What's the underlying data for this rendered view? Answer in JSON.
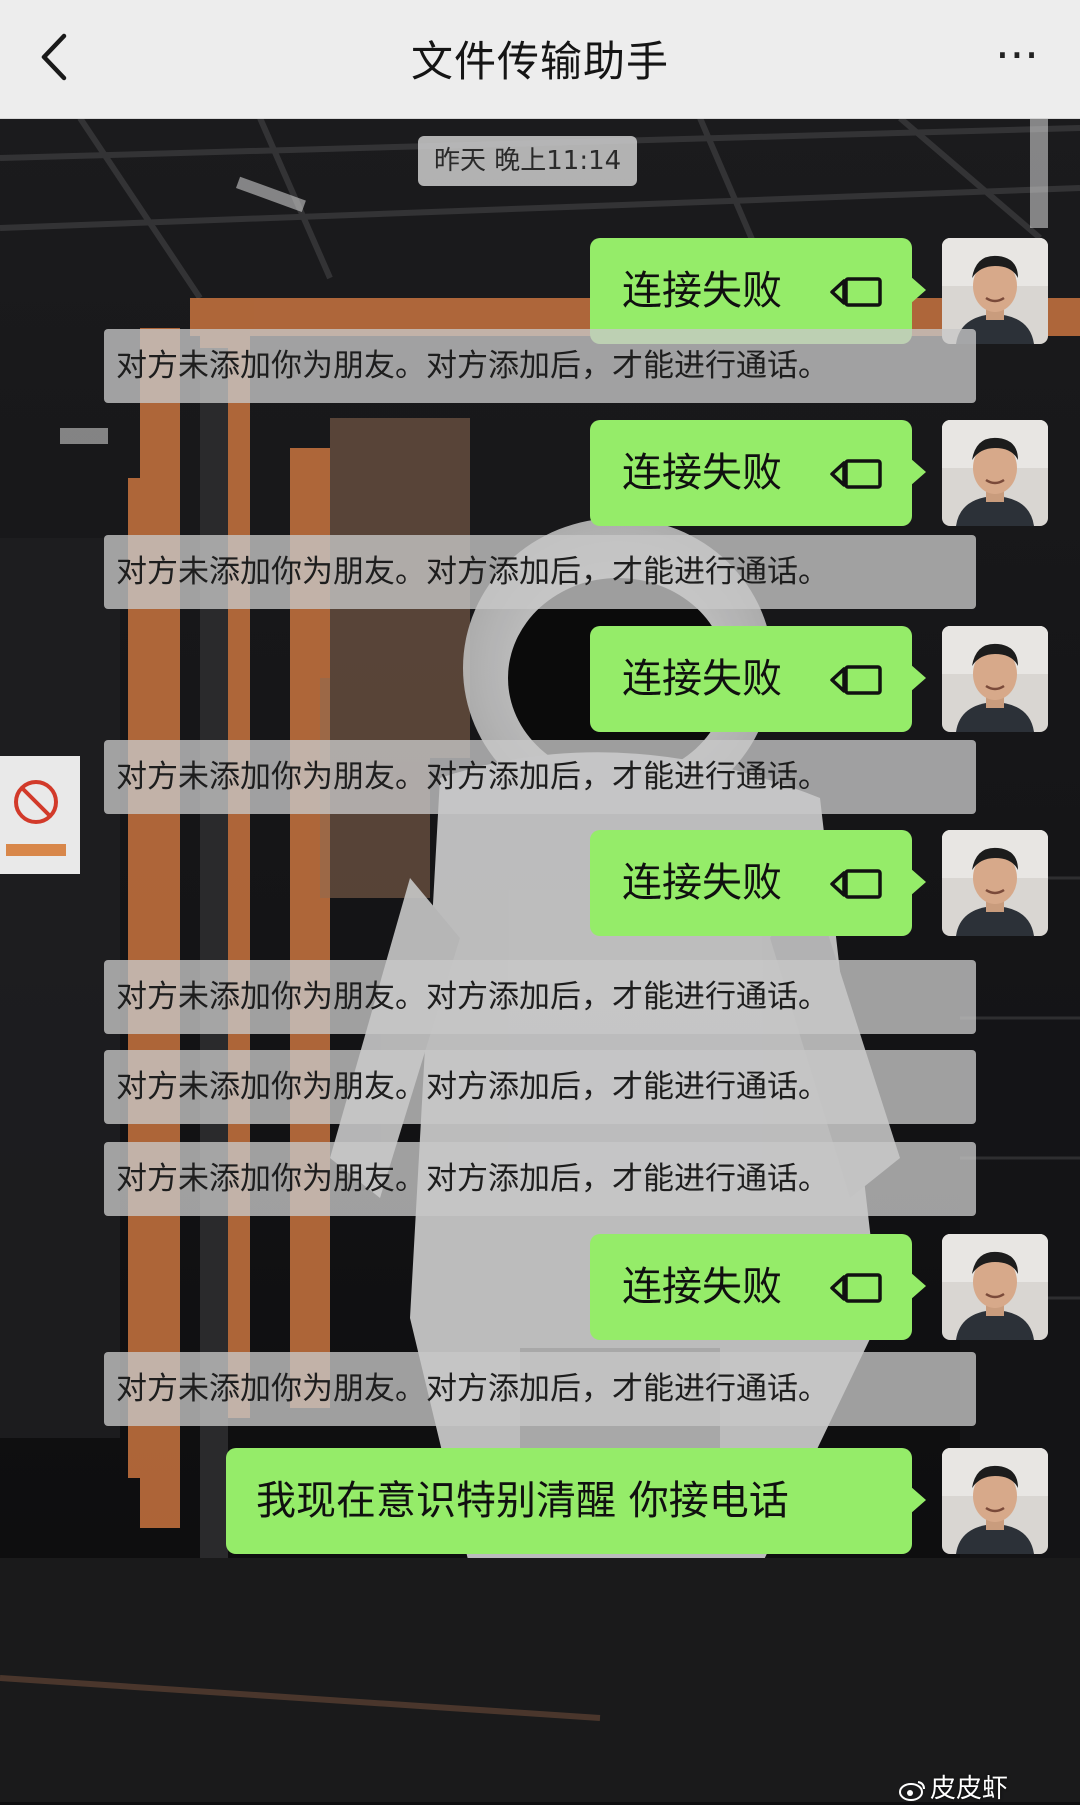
{
  "header": {
    "title": "文件传输助手",
    "back_icon": "chevron-left-icon",
    "more_label": "···"
  },
  "chat": {
    "timestamp": "昨天 晚上11:14",
    "call_failed_text": "连接失败",
    "notice_text": "对方未添加你为朋友。对方添加后，才能进行通话。",
    "last_message": "我现在意识特别清醒  你接电话",
    "call_icon": "video-call-icon",
    "bubble_color": "#95ec69"
  },
  "watermark": {
    "text": "皮皮虾"
  }
}
